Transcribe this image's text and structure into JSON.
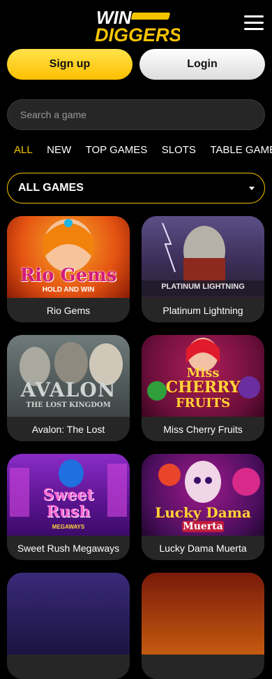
{
  "header": {
    "logo": {
      "line1": "WIN",
      "line2": "DIGGERS"
    },
    "menu_icon": "hamburger-icon"
  },
  "auth": {
    "signup_label": "Sign up",
    "login_label": "Login"
  },
  "search": {
    "placeholder": "Search a game",
    "value": ""
  },
  "tabs": [
    {
      "label": "ALL",
      "active": true
    },
    {
      "label": "NEW",
      "active": false
    },
    {
      "label": "TOP GAMES",
      "active": false
    },
    {
      "label": "SLOTS",
      "active": false
    },
    {
      "label": "TABLE GAMES",
      "active": false
    }
  ],
  "filter": {
    "selected": "ALL GAMES"
  },
  "colors": {
    "accent": "#f5c400",
    "card_bg": "#262626",
    "background": "#000000"
  },
  "games": [
    {
      "title": "Rio Gems",
      "art_text": [
        "Rio Gems",
        "HOLD AND WIN"
      ]
    },
    {
      "title": "Platinum Lightning",
      "art_text": [
        "PLATINUM",
        "LIGHTNING"
      ]
    },
    {
      "title": "Avalon: The Lost",
      "art_text": [
        "AVALON",
        "THE LOST KINGDOM"
      ]
    },
    {
      "title": "Miss Cherry Fruits",
      "art_text": [
        "Miss",
        "CHERRY",
        "FRUITS"
      ]
    },
    {
      "title": "Sweet Rush Megaways",
      "art_text": [
        "Sweet",
        "Rush",
        "MEGAWAYS"
      ]
    },
    {
      "title": "Lucky Dama Muerta",
      "art_text": [
        "Lucky Dama",
        "Muerta"
      ]
    }
  ]
}
